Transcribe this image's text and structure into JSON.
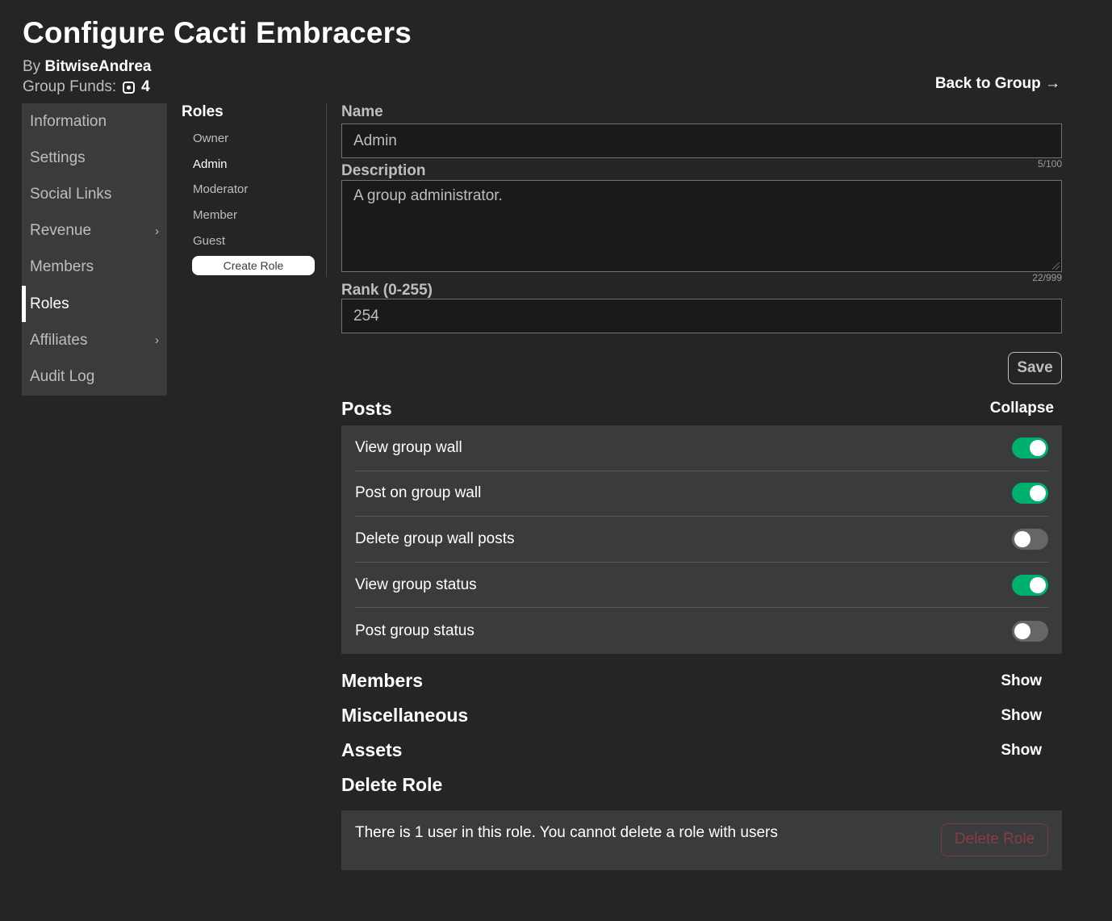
{
  "header": {
    "title": "Configure Cacti Embracers",
    "by_prefix": "By",
    "owner": "BitwiseAndrea",
    "funds_label": "Group Funds:",
    "funds_icon": "robux-icon",
    "funds_amount": "4",
    "back_link": "Back to Group →"
  },
  "sidebar": {
    "items": [
      {
        "label": "Information",
        "active": false,
        "chevron": false
      },
      {
        "label": "Settings",
        "active": false,
        "chevron": false
      },
      {
        "label": "Social Links",
        "active": false,
        "chevron": false
      },
      {
        "label": "Revenue",
        "active": false,
        "chevron": true
      },
      {
        "label": "Members",
        "active": false,
        "chevron": false
      },
      {
        "label": "Roles",
        "active": true,
        "chevron": false
      },
      {
        "label": "Affiliates",
        "active": false,
        "chevron": true
      },
      {
        "label": "Audit Log",
        "active": false,
        "chevron": false
      }
    ],
    "chevron_glyph": "›"
  },
  "roles": {
    "title": "Roles",
    "items": [
      "Owner",
      "Admin",
      "Moderator",
      "Member",
      "Guest"
    ],
    "active": "Admin",
    "create_button": "Create Role"
  },
  "form": {
    "name_label": "Name",
    "name_value": "Admin",
    "name_counter": "5/100",
    "description_label": "Description",
    "description_value": "A group administrator.",
    "description_counter": "22/999",
    "rank_label": "Rank (0-255)",
    "rank_value": "254",
    "save_button": "Save"
  },
  "posts": {
    "title": "Posts",
    "action": "Collapse",
    "permissions": [
      {
        "label": "View group wall",
        "enabled": true
      },
      {
        "label": "Post on group wall",
        "enabled": true
      },
      {
        "label": "Delete group wall posts",
        "enabled": false
      },
      {
        "label": "View group status",
        "enabled": true
      },
      {
        "label": "Post group status",
        "enabled": false
      }
    ]
  },
  "collapsed_sections": [
    {
      "title": "Members",
      "action": "Show"
    },
    {
      "title": "Miscellaneous",
      "action": "Show"
    },
    {
      "title": "Assets",
      "action": "Show"
    }
  ],
  "delete_role": {
    "title": "Delete Role",
    "message": "There is 1 user in this role. You cannot delete a role with users",
    "button": "Delete Role"
  },
  "colors": {
    "background": "#232527",
    "panel": "#393b3d",
    "toggle_on": "#00b06f",
    "toggle_off": "#656668",
    "danger": "#8a3c44"
  }
}
